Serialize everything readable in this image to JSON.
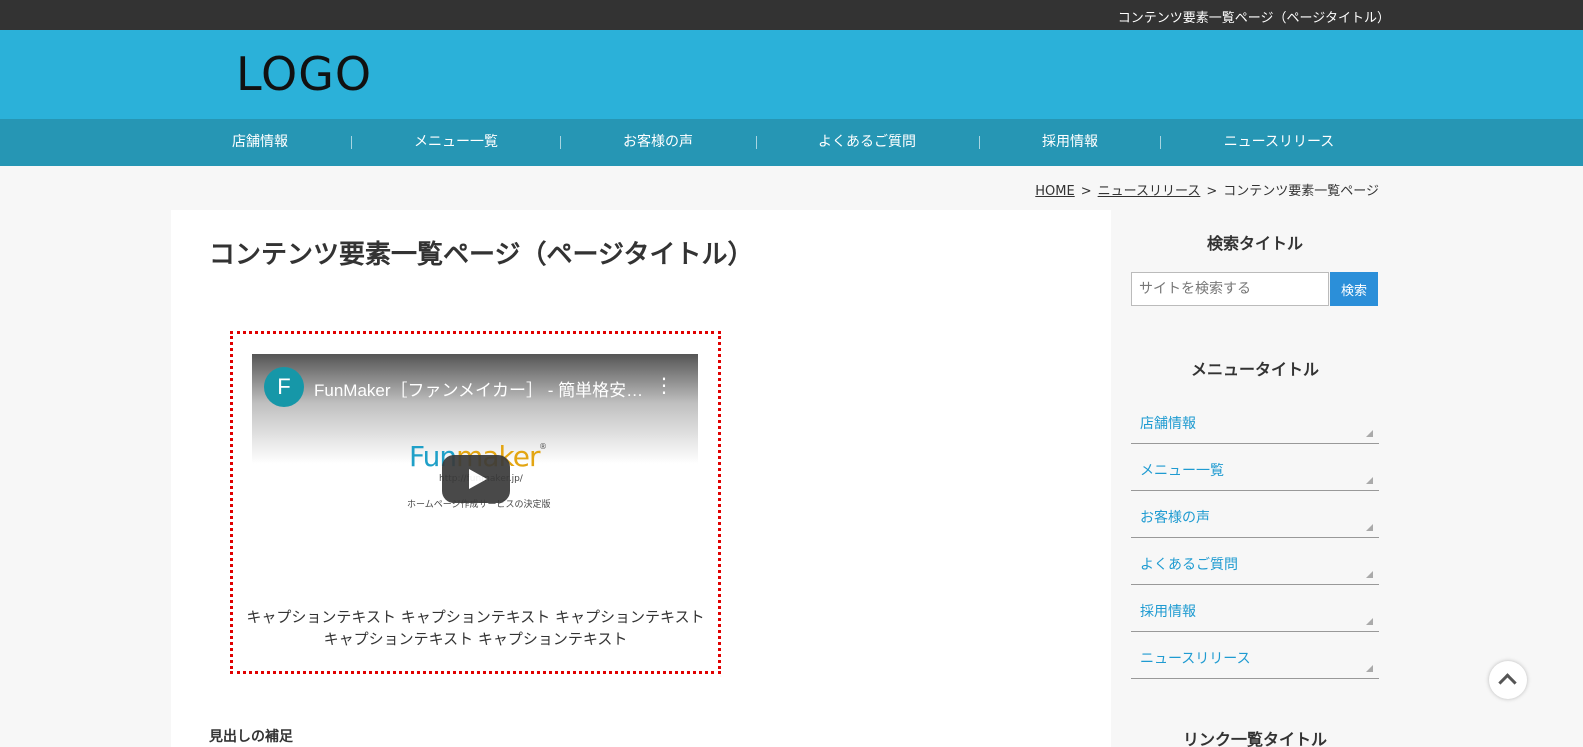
{
  "topbar": {
    "text": "コンテンツ要素一覧ページ（ページタイトル）"
  },
  "header": {
    "logo": "LOGO"
  },
  "nav": {
    "items": [
      {
        "label": "店舗情報"
      },
      {
        "label": "メニュー一覧"
      },
      {
        "label": "お客様の声"
      },
      {
        "label": "よくあるご質問"
      },
      {
        "label": "採用情報"
      },
      {
        "label": "ニュースリリース"
      }
    ]
  },
  "breadcrumb": {
    "home": "HOME",
    "sep": ">",
    "parent": "ニュースリリース",
    "current": "コンテンツ要素一覧ページ"
  },
  "main": {
    "title": "コンテンツ要素一覧ページ（ページタイトル）",
    "video": {
      "avatar_letter": "F",
      "title": "FunMaker［ファンメイカー］ - 簡単格安ホームページ作成",
      "logo_f": "Fun",
      "logo_rest": "maker",
      "logo_reg": "®",
      "url": "http://funmaker.jp/",
      "subtitle": "ホームページ作成サービスの決定版"
    },
    "caption_line1": "キャプションテキスト キャプションテキスト キャプションテキスト",
    "caption_line2": "キャプションテキスト キャプションテキスト",
    "subhead": "見出しの補足"
  },
  "sidebar": {
    "search_title": "検索タイトル",
    "search_placeholder": "サイトを検索する",
    "search_button": "検索",
    "menu_title": "メニュータイトル",
    "menu_items": [
      {
        "label": "店舗情報"
      },
      {
        "label": "メニュー一覧"
      },
      {
        "label": "お客様の声"
      },
      {
        "label": "よくあるご質問"
      },
      {
        "label": "採用情報"
      },
      {
        "label": "ニュースリリース"
      }
    ],
    "links_title": "リンク一覧タイトル"
  },
  "colors": {
    "topbar": "#333333",
    "header": "#2bb1d9",
    "nav": "#2696b4",
    "link": "#1f9bd1",
    "search_button": "#2b8fd9",
    "video_border": "#e00000"
  }
}
